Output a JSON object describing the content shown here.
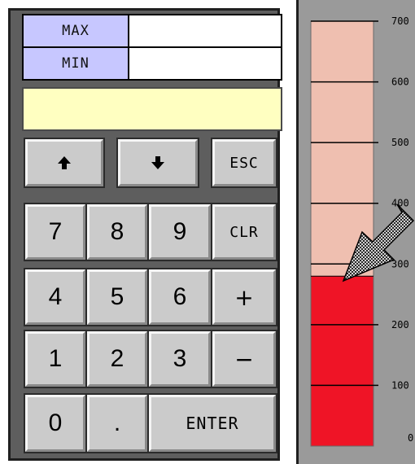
{
  "minmax": {
    "max_label": "MAX",
    "max_value": "",
    "min_label": "MIN",
    "min_value": ""
  },
  "entry": {
    "value": ""
  },
  "keys": {
    "up": "up-arrow",
    "down": "down-arrow",
    "esc": "ESC",
    "k7": "7",
    "k8": "8",
    "k9": "9",
    "clr": "CLR",
    "k4": "4",
    "k5": "5",
    "k6": "6",
    "plus": "+",
    "k1": "1",
    "k2": "2",
    "k3": "3",
    "minus": "−",
    "k0": "0",
    "dot": ".",
    "enter": "ENTER"
  },
  "gauge": {
    "ticks": [
      "0",
      "100",
      "200",
      "300",
      "400",
      "500",
      "600",
      "700"
    ],
    "current_value": 280,
    "max_value": 700,
    "colors": {
      "fill": "#ef1426",
      "background_bar": "#efbfb0",
      "panel": "#9a9a9a"
    }
  }
}
